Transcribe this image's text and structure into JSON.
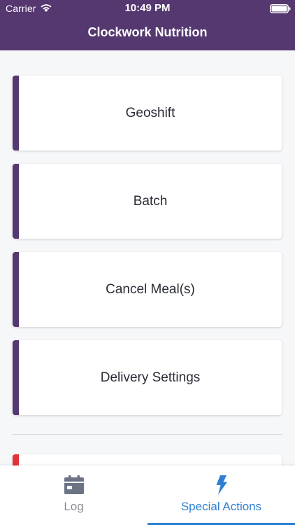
{
  "status_bar": {
    "carrier": "Carrier",
    "time": "10:49 PM"
  },
  "header": {
    "title": "Clockwork Nutrition"
  },
  "actions": [
    {
      "label": "Geoshift"
    },
    {
      "label": "Batch"
    },
    {
      "label": "Cancel Meal(s)"
    },
    {
      "label": "Delivery Settings"
    }
  ],
  "tabs": [
    {
      "label": "Log",
      "icon": "calendar-icon",
      "active": false
    },
    {
      "label": "Special Actions",
      "icon": "lightning-bolt-icon",
      "active": true
    }
  ],
  "colors": {
    "header_bg": "#553870",
    "card_accent": "#553870",
    "partial_card_accent": "#e0343a",
    "active_tab": "#2d7fd1",
    "inactive_tab": "#8a8c94",
    "background": "#f6f7f9"
  }
}
